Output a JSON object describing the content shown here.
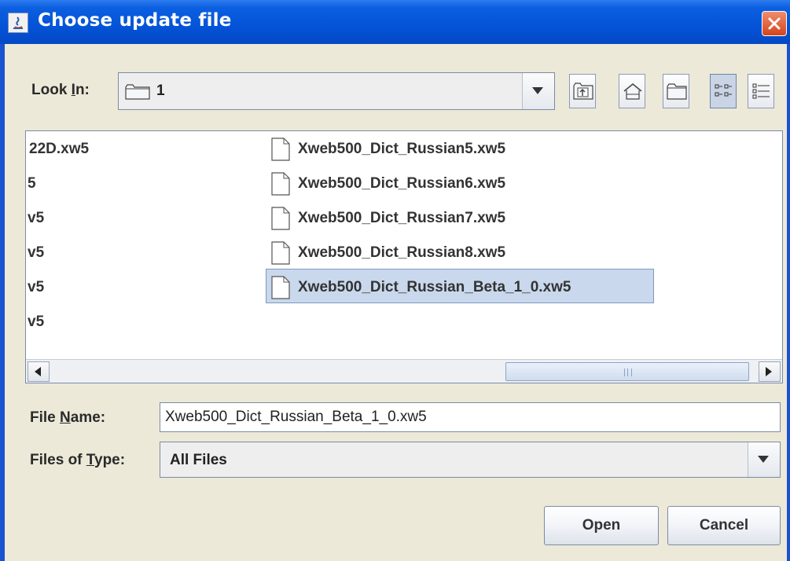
{
  "window": {
    "title": "Choose update file"
  },
  "look_in": {
    "label": "Look In:",
    "mnemonic": "I",
    "value": "1"
  },
  "toolbar": {
    "buttons": [
      {
        "name": "up-one-level",
        "icon": "folder-up-icon"
      },
      {
        "name": "home",
        "icon": "home-icon"
      },
      {
        "name": "new-folder",
        "icon": "new-folder-icon"
      },
      {
        "name": "list-view",
        "icon": "list-view-icon",
        "pressed": true
      },
      {
        "name": "details-view",
        "icon": "details-view-icon"
      }
    ]
  },
  "file_list": {
    "left_column": [
      "22D.xw5",
      "5",
      "v5",
      "v5",
      "v5",
      "v5"
    ],
    "right_column": [
      "Xweb500_Dict_Russian5.xw5",
      "Xweb500_Dict_Russian6.xw5",
      "Xweb500_Dict_Russian7.xw5",
      "Xweb500_Dict_Russian8.xw5",
      "Xweb500_Dict_Russian_Beta_1_0.xw5"
    ],
    "selected": "Xweb500_Dict_Russian_Beta_1_0.xw5"
  },
  "file_name": {
    "label_pre": "File ",
    "label_mn": "N",
    "label_post": "ame:",
    "value": "Xweb500_Dict_Russian_Beta_1_0.xw5"
  },
  "file_type": {
    "label_pre": "Files of ",
    "label_mn": "T",
    "label_post": "ype:",
    "value": "All Files"
  },
  "buttons": {
    "open": "Open",
    "cancel": "Cancel"
  }
}
